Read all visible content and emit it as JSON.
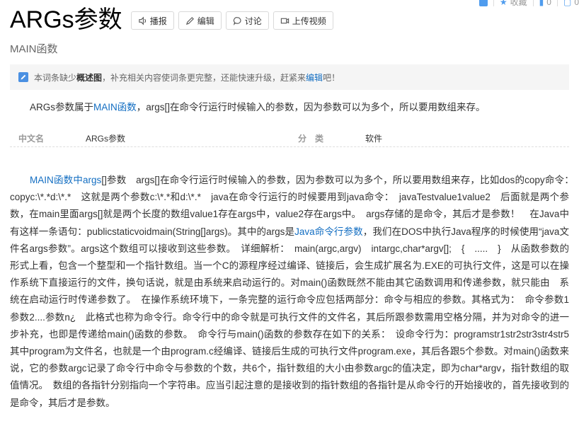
{
  "topbar": {
    "collect_label": "收藏",
    "count1": "0",
    "count2": "0"
  },
  "title": "ARGs参数",
  "buttons": {
    "broadcast": "播报",
    "edit": "编辑",
    "discuss": "讨论",
    "upload": "上传视频"
  },
  "subtitle": "MAIN函数",
  "notice": {
    "prefix": "本词条缺少",
    "bold": "概述图",
    "middle": "，补充相关内容使词条更完整，还能快速升级，赶紧来",
    "link": "编辑",
    "suffix": "吧！"
  },
  "intro": {
    "prefix": "ARGs参数属于",
    "link": "MAIN函数",
    "suffix": "，args[]在命令行运行时候输入的参数，因为参数可以为多个，所以要用数组来存。"
  },
  "basic_info": {
    "k1": "中文名",
    "v1": "ARGs参数",
    "k2": "分　类",
    "v2": "软件"
  },
  "body": {
    "link1": "MAIN函数中args",
    "t1": "[]参数　args[]在命令行运行时候输入的参数，因为参数可以为多个，所以要用数组来存，比如dos的copy命令：　copyc:\\*.*d:\\*.*　这就是两个参数c:\\*.*和d:\\*.*　java在命令行运行的时候要用到java命令：　javaTestvalue1value2　后面就是两个参数，在main里面args[]就是两个长度的数组value1存在args中，value2存在args中。　args存储的是命令，其后才是参数！　在Java中有这样一条语句：publicstaticvoidmain(String[]args)。其中的args是",
    "link2": "Java命令行参数",
    "t2": "，我们在DOS中执行Java程序的时候使用“java文件名args参数”。args这个数组可以接收到这些参数。　详细解析：　main(argc,argv)　intargc,char*argv[];　{　.....　}　从函数参数的形式上看，包含一个整型和一个指针数组。当一个C的源程序经过编译、链接后，会生成扩展名为.EXE的可执行文件，这是可以在操作系统下直接运行的文件，换句话说，就是由系统来启动运行的。对main()函数既然不能由其它函数调用和传递参数，就只能由　系统在启动运行时传递参数了。　在操作系统环境下，一条完整的运行命令应包括两部分：命令与相应的参数。其格式为：　命令参数1参数2....参数n¿　此格式也称为命令行。命令行中的命令就是可执行文件的文件名，其后所跟参数需用空格分隔，并为对命令的进一步补充，也即是传递给main()函数的参数。　命令行与main()函数的参数存在如下的关系：　设命令行为：programstr1str2str3str4str5　其中program为文件名，也就是一个由program.c经编译、链接后生成的可执行文件program.exe，其后各跟5个参数。对main()函数来说，它的参数argc记录了命令行中命令与参数的个数，共6个，指针数组的大小由参数argc的值决定，即为char*argv，指针数组的取值情况。　数组的各指针分别指向一个字符串。应当引起注意的是接收到的指针数组的各指针是从命令行的开始接收的，首先接收到的是命令，其后才是参数。"
  }
}
